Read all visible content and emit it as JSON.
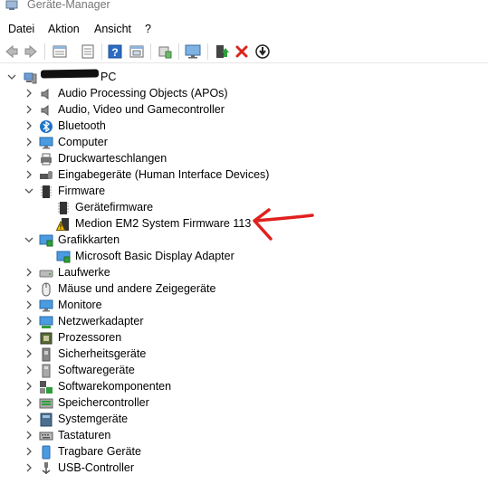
{
  "window": {
    "title": "Geräte-Manager",
    "app_icon": "device-manager-icon"
  },
  "menu": {
    "items": [
      "Datei",
      "Aktion",
      "Ansicht",
      "?"
    ]
  },
  "toolbar": {
    "buttons": [
      "back-icon",
      "forward-icon",
      "properties-grid-icon",
      "properties-icon",
      "help-icon",
      "show-hidden-icon",
      "scan-hardware-icon",
      "monitor-icon",
      "update-driver-icon",
      "uninstall-icon",
      "disable-icon"
    ]
  },
  "tree": {
    "root": {
      "label": "PC",
      "redacted": true,
      "icon": "computer-icon"
    },
    "items": [
      {
        "label": "Audio Processing Objects (APOs)",
        "icon": "speaker-icon",
        "expanded": false
      },
      {
        "label": "Audio, Video und Gamecontroller",
        "icon": "speaker-icon",
        "expanded": false
      },
      {
        "label": "Bluetooth",
        "icon": "bluetooth-icon",
        "expanded": false
      },
      {
        "label": "Computer",
        "icon": "monitor-icon",
        "expanded": false
      },
      {
        "label": "Druckwarteschlangen",
        "icon": "printer-icon",
        "expanded": false
      },
      {
        "label": "Eingabegeräte (Human Interface Devices)",
        "icon": "hid-icon",
        "expanded": false
      },
      {
        "label": "Firmware",
        "icon": "chip-icon",
        "expanded": true,
        "children": [
          {
            "label": "Gerätefirmware",
            "icon": "chip-icon"
          },
          {
            "label": "Medion EM2 System Firmware 113",
            "icon": "chip-warning-icon",
            "warning": true
          }
        ]
      },
      {
        "label": "Grafikkarten",
        "icon": "display-adapter-icon",
        "expanded": true,
        "children": [
          {
            "label": "Microsoft Basic Display Adapter",
            "icon": "display-adapter-icon"
          }
        ]
      },
      {
        "label": "Laufwerke",
        "icon": "drive-icon",
        "expanded": false
      },
      {
        "label": "Mäuse und andere Zeigegeräte",
        "icon": "mouse-icon",
        "expanded": false
      },
      {
        "label": "Monitore",
        "icon": "monitor-icon",
        "expanded": false
      },
      {
        "label": "Netzwerkadapter",
        "icon": "network-icon",
        "expanded": false
      },
      {
        "label": "Prozessoren",
        "icon": "cpu-icon",
        "expanded": false
      },
      {
        "label": "Sicherheitsgeräte",
        "icon": "security-icon",
        "expanded": false
      },
      {
        "label": "Softwaregeräte",
        "icon": "software-device-icon",
        "expanded": false
      },
      {
        "label": "Softwarekomponenten",
        "icon": "software-component-icon",
        "expanded": false
      },
      {
        "label": "Speichercontroller",
        "icon": "storage-icon",
        "expanded": false
      },
      {
        "label": "Systemgeräte",
        "icon": "system-icon",
        "expanded": false
      },
      {
        "label": "Tastaturen",
        "icon": "keyboard-icon",
        "expanded": false
      },
      {
        "label": "Tragbare Geräte",
        "icon": "portable-icon",
        "expanded": false
      },
      {
        "label": "USB-Controller",
        "icon": "usb-icon",
        "expanded": false
      }
    ]
  },
  "annotation": {
    "shape": "red-arrow",
    "color": "#e0201e",
    "points_to": "Medion EM2 System Firmware 113"
  },
  "colors": {
    "accent_blue": "#1e73c8",
    "warning_yellow": "#f5c400",
    "annotation_red": "#e0201e",
    "uninstall_red": "#d9261c",
    "update_green": "#2f9e3a"
  }
}
